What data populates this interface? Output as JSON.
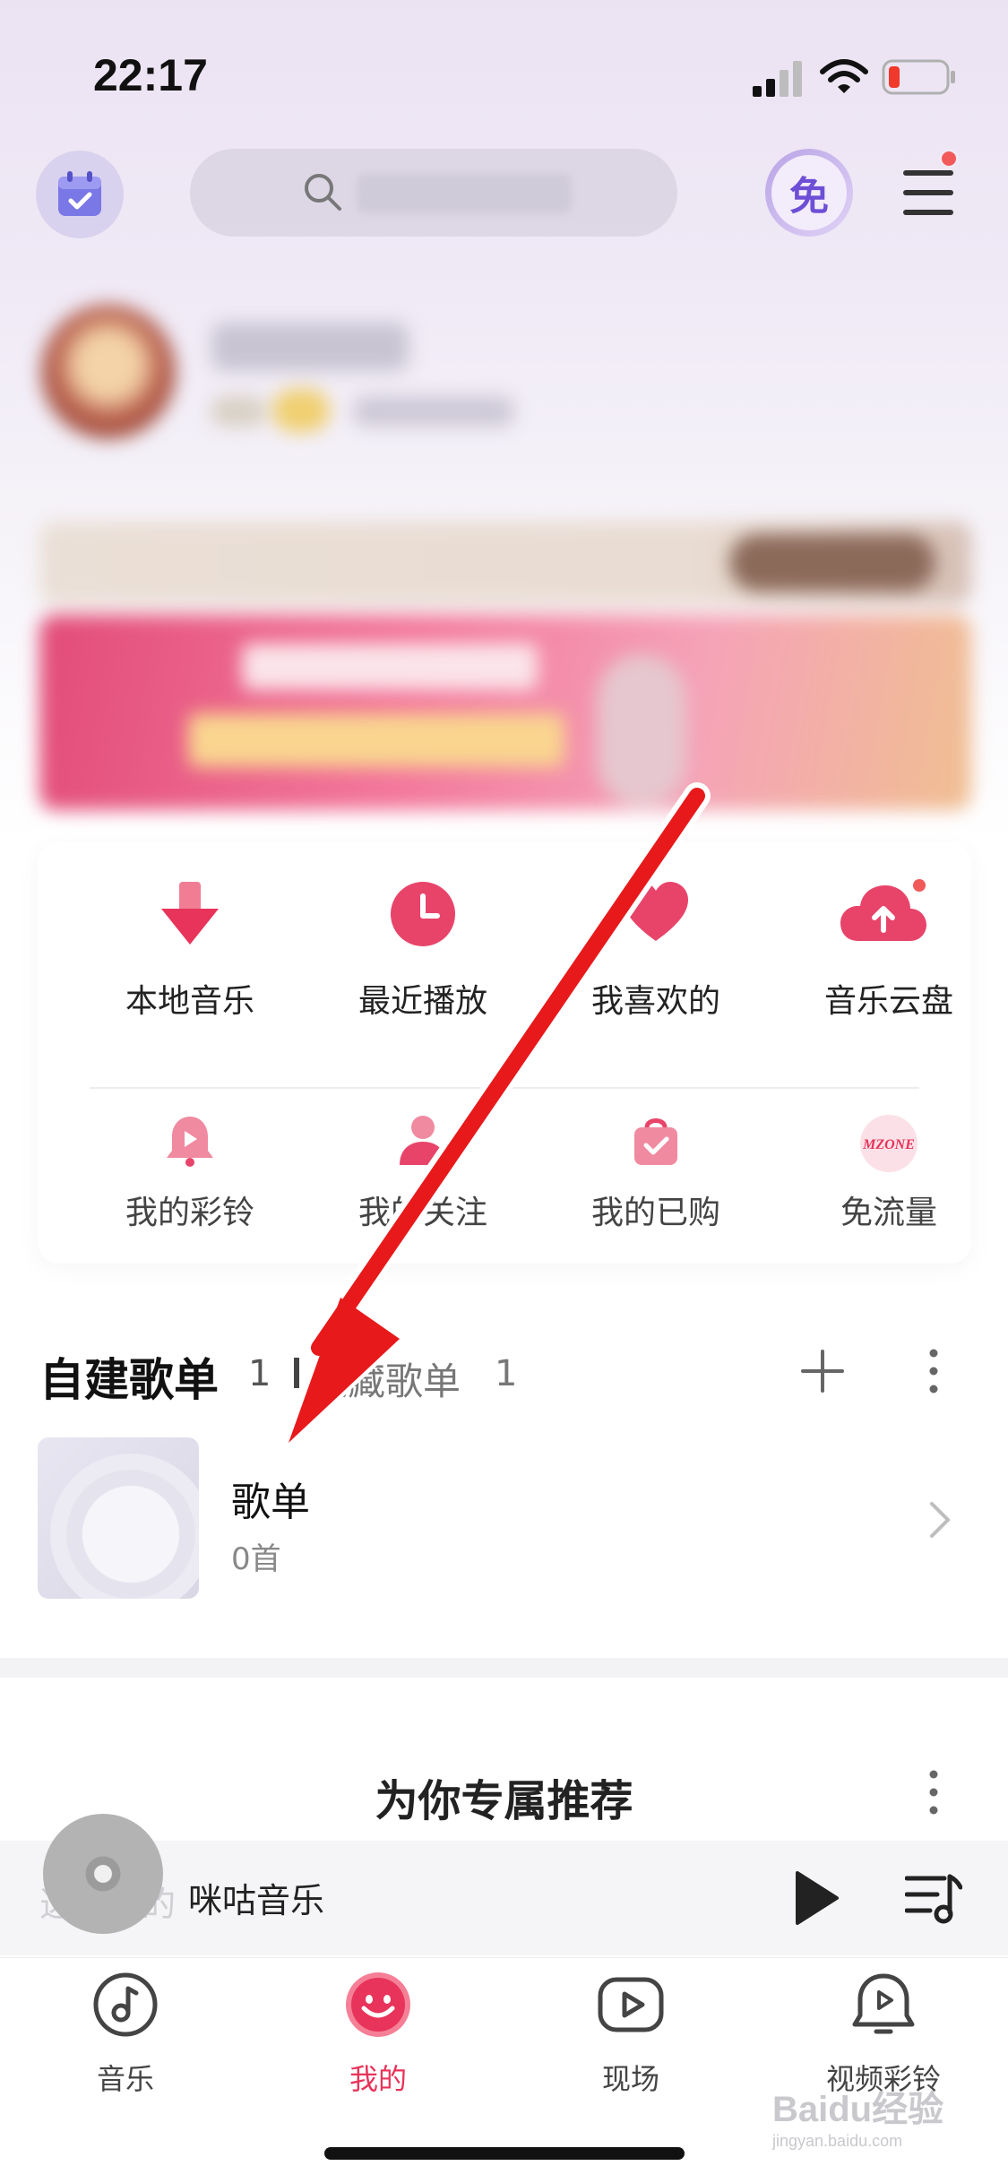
{
  "status_bar": {
    "time": "22:17"
  },
  "colors": {
    "accent": "#e8335a",
    "arrow": "#e8191b",
    "quick_icon": "#e8446a"
  },
  "quick_access": {
    "row1": [
      {
        "label": "本地音乐",
        "icon": "download-arrow-icon"
      },
      {
        "label": "最近播放",
        "icon": "clock-icon"
      },
      {
        "label": "我喜欢的",
        "icon": "heart-icon"
      },
      {
        "label": "音乐云盘",
        "icon": "cloud-upload-icon"
      }
    ],
    "row2": [
      {
        "label": "我的彩铃",
        "icon": "bell-icon"
      },
      {
        "label": "我的关注",
        "icon": "person-icon"
      },
      {
        "label": "我的已购",
        "icon": "shopping-bag-icon"
      },
      {
        "label": "免流量",
        "icon": "mzone-icon",
        "logo_text": "MZONE"
      }
    ]
  },
  "header": {
    "free_badge": "免"
  },
  "playlists": {
    "tab_self": "自建歌单",
    "tab_self_count": "1",
    "tab_collected": "收藏歌单",
    "tab_collected_count": "1",
    "items": [
      {
        "title": "歌单",
        "count": "0首"
      }
    ]
  },
  "recommend": {
    "title": "为你专属推荐"
  },
  "mini_player": {
    "title": "咪咕音乐",
    "obscured_text": "选择你的"
  },
  "bottom_nav": {
    "items": [
      {
        "label": "音乐",
        "icon": "music-note-icon"
      },
      {
        "label": "我的",
        "icon": "smiley-icon",
        "active": true
      },
      {
        "label": "现场",
        "icon": "video-play-icon"
      },
      {
        "label": "视频彩铃",
        "icon": "video-bell-icon"
      }
    ]
  },
  "watermark": {
    "brand": "Baidu经验",
    "url": "jingyan.baidu.com"
  }
}
